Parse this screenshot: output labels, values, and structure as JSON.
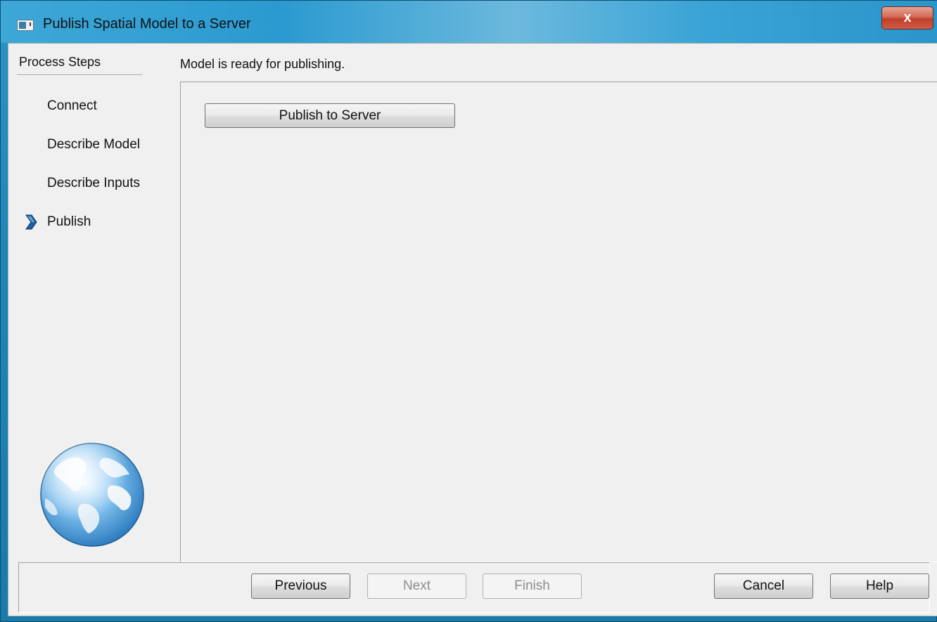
{
  "window": {
    "title": "Publish Spatial Model to a Server",
    "close_label": "x"
  },
  "sidebar": {
    "header": "Process Steps",
    "steps": [
      {
        "label": "Connect"
      },
      {
        "label": "Describe Model"
      },
      {
        "label": "Describe Inputs"
      },
      {
        "label": "Publish",
        "current": true
      }
    ]
  },
  "main": {
    "status": "Model is ready for publishing.",
    "publish_button": "Publish to Server"
  },
  "footer": {
    "previous": "Previous",
    "next": "Next",
    "finish": "Finish",
    "cancel": "Cancel",
    "help": "Help"
  },
  "icons": {
    "app": "app-window-icon",
    "current_step": "chevron-right-icon",
    "logo": "globe-icon"
  },
  "colors": {
    "frame": "#1f86b8",
    "client": "#f0f0f0",
    "close": "#c0402a",
    "step_arrow": "#1f5f9f"
  }
}
